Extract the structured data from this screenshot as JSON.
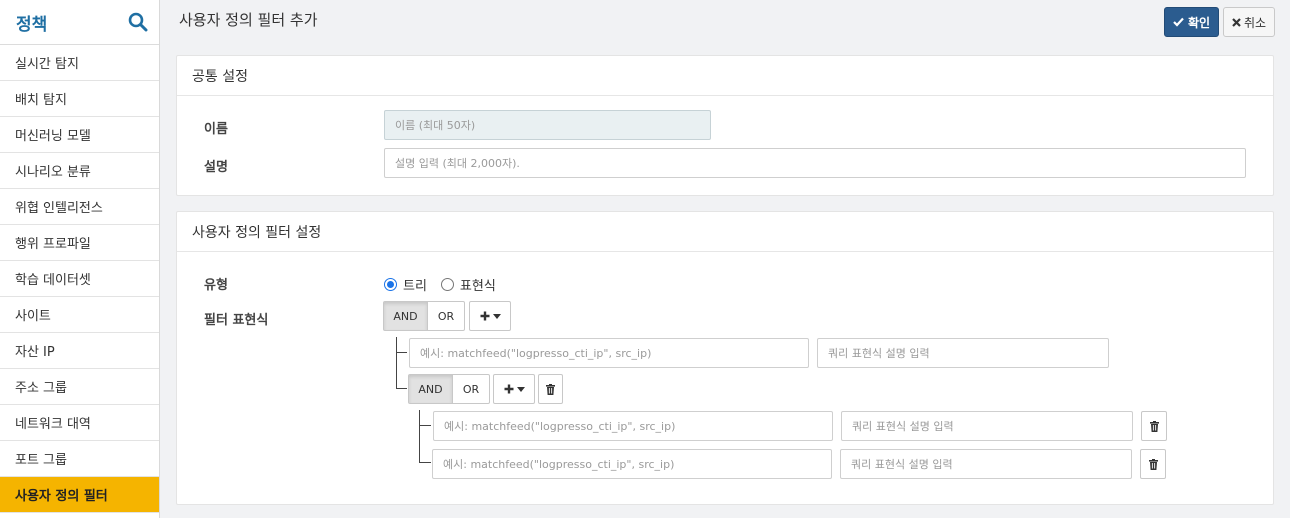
{
  "sidebar": {
    "title": "정책",
    "items": [
      {
        "label": "실시간 탐지"
      },
      {
        "label": "배치 탐지"
      },
      {
        "label": "머신러닝 모델"
      },
      {
        "label": "시나리오 분류"
      },
      {
        "label": "위협 인텔리전스"
      },
      {
        "label": "행위 프로파일"
      },
      {
        "label": "학습 데이터셋"
      },
      {
        "label": "사이트"
      },
      {
        "label": "자산 IP"
      },
      {
        "label": "주소 그룹"
      },
      {
        "label": "네트워크 대역"
      },
      {
        "label": "포트 그룹"
      },
      {
        "label": "사용자 정의 필터"
      }
    ],
    "active_label": "사용자 정의 필터"
  },
  "header": {
    "title": "사용자 정의 필터 추가",
    "confirm_label": "확인",
    "cancel_label": "취소"
  },
  "common": {
    "heading": "공통 설정",
    "name_label": "이름",
    "name_placeholder": "이름 (최대 50자)",
    "desc_label": "설명",
    "desc_placeholder": "설명 입력 (최대 2,000자)."
  },
  "filter": {
    "heading": "사용자 정의 필터 설정",
    "type_label": "유형",
    "type_options": [
      "트리",
      "표현식"
    ],
    "type_selected": "트리",
    "expr_label": "필터 표현식",
    "and_label": "AND",
    "or_label": "OR",
    "expr_placeholder": "예시: matchfeed(\"logpresso_cti_ip\", src_ip)",
    "query_desc_placeholder": "쿼리 표현식 설명 입력"
  },
  "colors": {
    "active_item": "#f5b400",
    "primary_button": "#2b5c8f",
    "title_accent": "#1f6fa3",
    "radio_accent": "#1a73e8"
  },
  "icons": {
    "search": "search-icon",
    "check": "check-icon",
    "close": "close-icon",
    "plus": "plus-icon",
    "caret": "caret-down-icon",
    "trash": "trash-icon"
  }
}
